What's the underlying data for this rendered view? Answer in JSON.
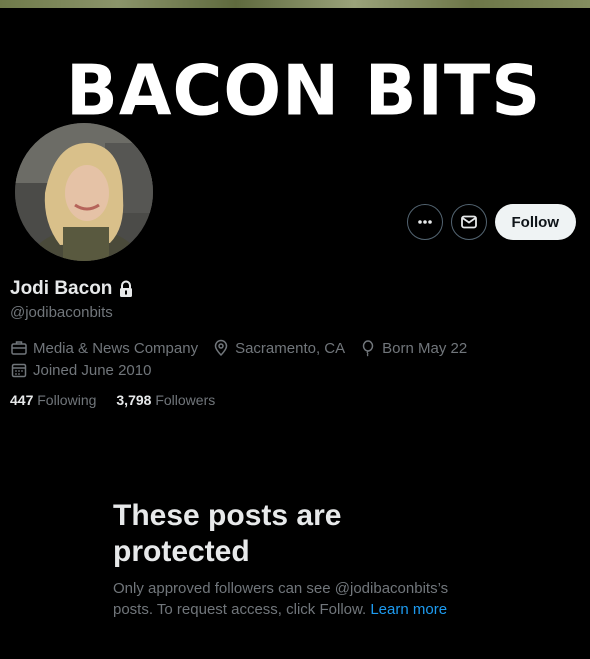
{
  "banner": {
    "text": "BACON BITS"
  },
  "profile": {
    "name": "Jodi Bacon",
    "handle": "@jodibaconbits",
    "category": "Media & News Company",
    "location": "Sacramento, CA",
    "born": "Born May 22",
    "joined": "Joined June 2010",
    "following_count": "447",
    "following_label": "Following",
    "followers_count": "3,798",
    "followers_label": "Followers"
  },
  "actions": {
    "follow_label": "Follow"
  },
  "protected": {
    "title": "These posts are protected",
    "body": "Only approved followers can see @jodibaconbits’s posts. To request access, click Follow.",
    "link": "Learn more"
  },
  "colors": {
    "link": "#1d9bf0",
    "muted": "#71767b",
    "text": "#e7e9ea"
  }
}
